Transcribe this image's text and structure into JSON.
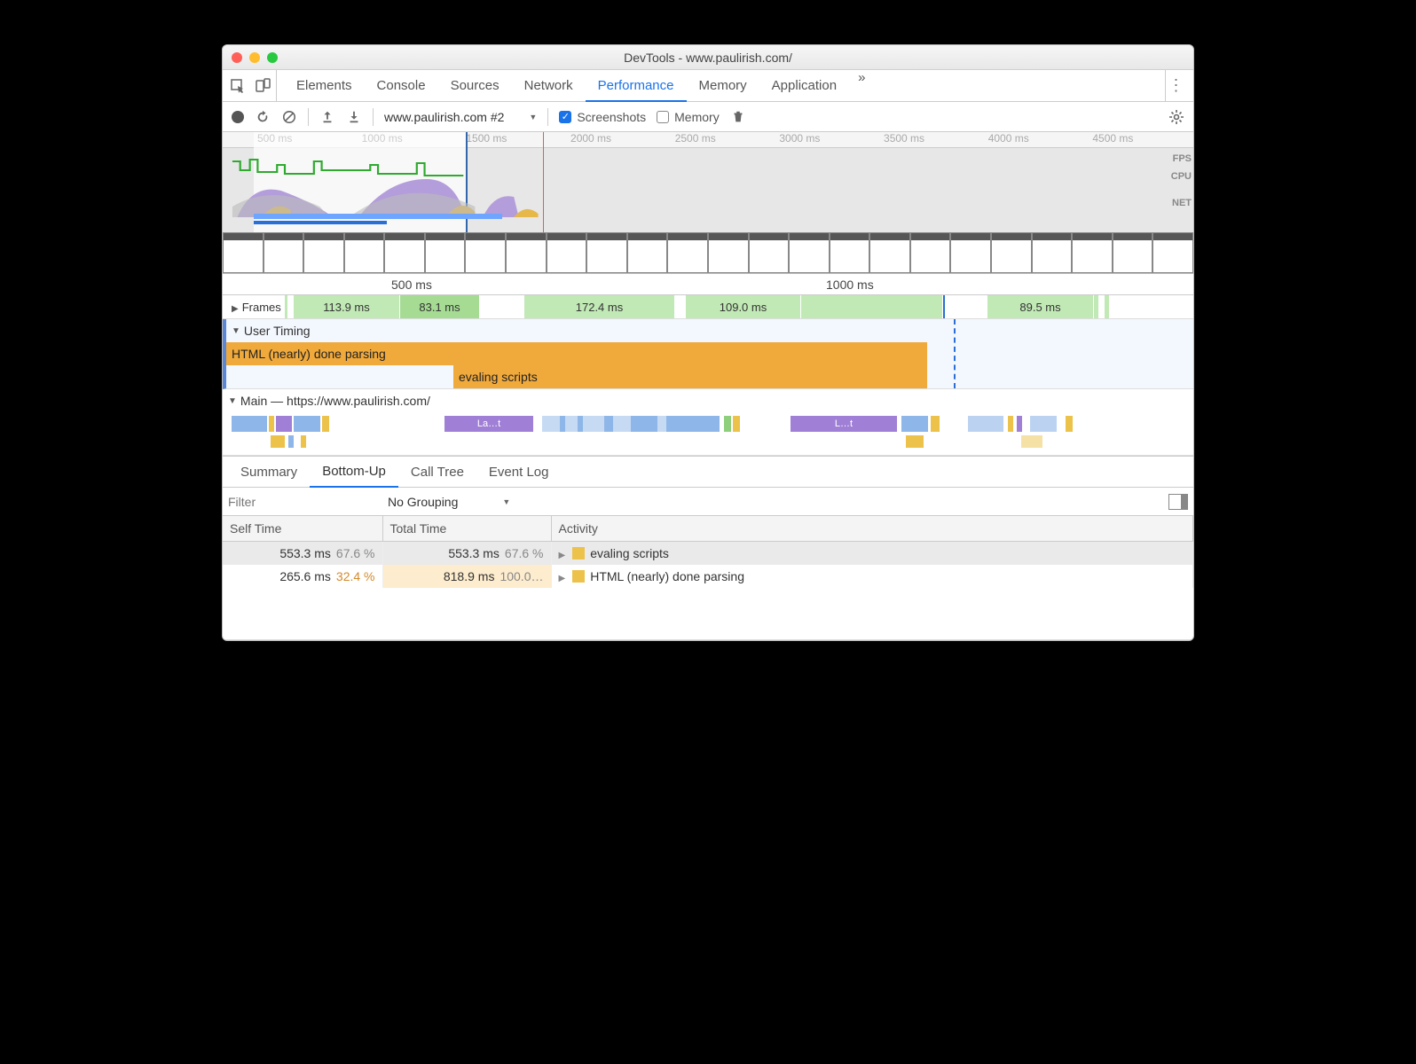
{
  "window": {
    "title": "DevTools - www.paulirish.com/"
  },
  "tabs": {
    "items": [
      "Elements",
      "Console",
      "Sources",
      "Network",
      "Performance",
      "Memory",
      "Application"
    ],
    "active": "Performance",
    "overflow": "»"
  },
  "toolbar": {
    "recording_label": "www.paulirish.com #2",
    "screenshots_label": "Screenshots",
    "screenshots_checked": true,
    "memory_label": "Memory",
    "memory_checked": false
  },
  "overview": {
    "ticks": [
      "500 ms",
      "1000 ms",
      "1500 ms",
      "2000 ms",
      "2500 ms",
      "3000 ms",
      "3500 ms",
      "4000 ms",
      "4500 ms"
    ],
    "lanes": [
      "FPS",
      "CPU",
      "NET"
    ]
  },
  "ruler": {
    "marks": [
      "500 ms",
      "1000 ms"
    ]
  },
  "frames": {
    "label": "Frames",
    "items": [
      "113.9 ms",
      "83.1 ms",
      "172.4 ms",
      "109.0 ms",
      "89.5 ms"
    ]
  },
  "user_timing": {
    "label": "User Timing",
    "bars": [
      "HTML (nearly) done parsing",
      "evaling scripts"
    ]
  },
  "main": {
    "label": "Main — https://www.paulirish.com/",
    "sample_labels": [
      "La…t",
      "L…t"
    ]
  },
  "details": {
    "tabs": [
      "Summary",
      "Bottom-Up",
      "Call Tree",
      "Event Log"
    ],
    "active": "Bottom-Up",
    "filter_placeholder": "Filter",
    "grouping": "No Grouping",
    "columns": {
      "self": "Self Time",
      "total": "Total Time",
      "activity": "Activity"
    },
    "rows": [
      {
        "self_ms": "553.3 ms",
        "self_pct": "67.6 %",
        "total_ms": "553.3 ms",
        "total_pct": "67.6 %",
        "activity": "evaling scripts",
        "selected": true
      },
      {
        "self_ms": "265.6 ms",
        "self_pct": "32.4 %",
        "total_ms": "818.9 ms",
        "total_pct": "100.0…",
        "activity": "HTML (nearly) done parsing",
        "selected": false,
        "total_highlight": true,
        "self_pct_warm": true
      }
    ]
  }
}
